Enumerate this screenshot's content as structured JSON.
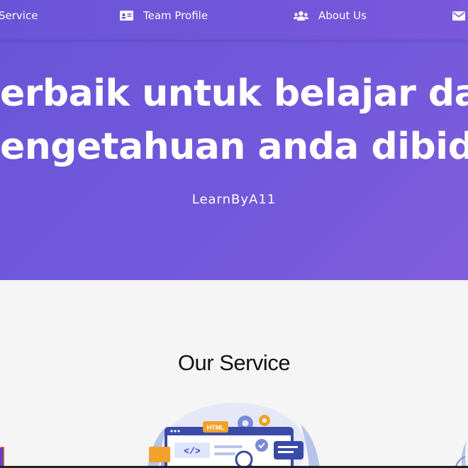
{
  "nav": {
    "items": [
      {
        "label": "Service",
        "icon": "service-icon"
      },
      {
        "label": "Team Profile",
        "icon": "id-card-icon"
      },
      {
        "label": "About Us",
        "icon": "users-icon"
      },
      {
        "label": "",
        "icon": "envelope-icon"
      }
    ]
  },
  "hero": {
    "line1": "erbaik untuk belajar dan me",
    "line2": "engetahuan anda dibidang I",
    "subtitle": "LearnByA11"
  },
  "services": {
    "title": "Our Service",
    "illustration_label": "HTML",
    "code_label": "</>"
  },
  "colors": {
    "primary": "#6a55d8",
    "hero_end": "#805ddd",
    "section_bg": "#f5f5f5"
  }
}
